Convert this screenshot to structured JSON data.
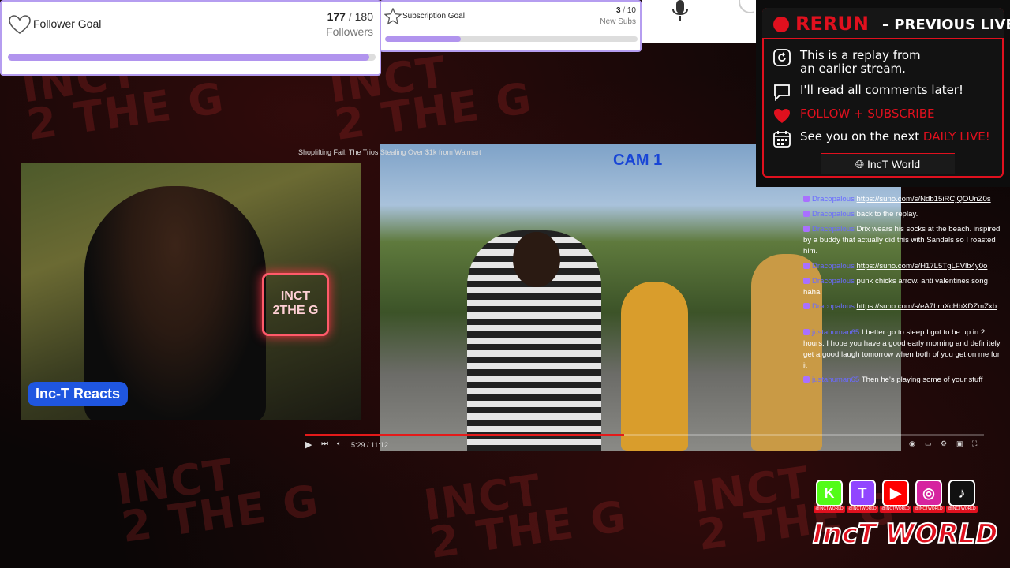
{
  "follower_goal": {
    "title": "Follower Goal",
    "current": "177",
    "separator": "/",
    "target": "180",
    "unit": "Followers",
    "progress": 0.983,
    "icon": "heart-outline-icon"
  },
  "subscription_goal": {
    "title": "Subscription Goal",
    "current": "3",
    "separator": "/",
    "target": "10",
    "unit": "New Subs",
    "progress": 0.3,
    "icon": "star-outline-icon"
  },
  "background": {
    "watermark_text": "INCT\n2 THE G"
  },
  "webcam": {
    "label": "Inc-T Reacts",
    "neon_sign": "INCT 2THE G"
  },
  "clip": {
    "title": "Shoplifting Fail: The Trios Stealing Over $1k from Walmart",
    "badge": "CAM 1",
    "time": "5:29 / 11:12",
    "played_fraction": 0.47
  },
  "rerun_panel": {
    "title": "RERUN",
    "subtitle": "– PREVIOUS LIVE",
    "lines": [
      {
        "icon": "replay-icon",
        "text1": "This is a replay from",
        "text2": "an earlier stream."
      },
      {
        "icon": "chat-bubble-icon",
        "text1": "I'll read all comments later!"
      },
      {
        "icon": "heart-icon",
        "text1": "FOLLOW + SUBSCRIBE"
      },
      {
        "icon": "calendar-icon",
        "text1": "See you on the next ",
        "highlight": "DAILY LIVE!"
      }
    ],
    "footer": "IncT World",
    "accent_color": "#e0101e"
  },
  "chat": {
    "messages": [
      {
        "user": "Dracopalous",
        "text": "https://suno.com/s/Ndb15iRCjQOUnZ0s",
        "is_link": true
      },
      {
        "user": "Dracopalous",
        "text": "back to the replay.",
        "is_link": false
      },
      {
        "user": "Dracopalous",
        "text": "Drix wears his socks at the beach. inspired by a buddy that actually did this with Sandals so I roasted him.",
        "is_link": false
      },
      {
        "user": "Dracopalous",
        "text": "https://suno.com/s/H17L5TgLFVlb4y0o",
        "is_link": true
      },
      {
        "user": "Dracopalous",
        "text": "punk chicks arrow. anti valentines song haha",
        "is_link": false
      },
      {
        "user": "Dracopalous",
        "text": "https://suno.com/s/eA7LmXcHbXDZmZxb",
        "is_link": true
      },
      {
        "user": "justahuman65",
        "text": "I better go to sleep I got to be up in 2 hours. I hope you have a good early morning and definitely get a good laugh tomorrow when both of you get on me for it",
        "is_link": false
      },
      {
        "user": "justahuman65",
        "text": "Then he's playing some of your stuff",
        "is_link": false
      }
    ]
  },
  "socials": {
    "items": [
      {
        "name": "kick",
        "glyph": "K",
        "color": "#53fc18",
        "handle": "@INCTWORLD"
      },
      {
        "name": "twitch",
        "glyph": "T",
        "color": "#9146ff",
        "handle": "@INCTWORLD"
      },
      {
        "name": "youtube",
        "glyph": "▶",
        "color": "#ff0000",
        "handle": "@INCTWORLD"
      },
      {
        "name": "instagram",
        "glyph": "◎",
        "color": "#d6249f",
        "handle": "@INCTWORLD"
      },
      {
        "name": "tiktok",
        "glyph": "♪",
        "color": "#111111",
        "handle": "@INCTWORLD"
      }
    ],
    "brand": "IncT WORLD"
  }
}
